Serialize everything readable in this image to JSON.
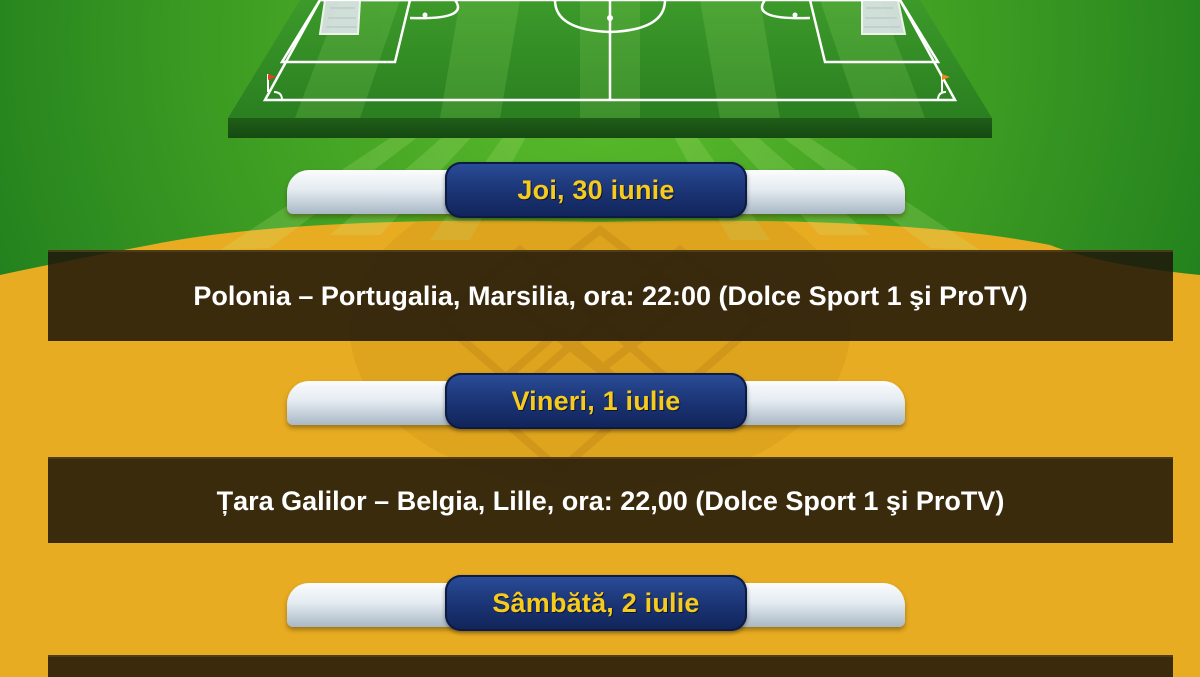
{
  "colors": {
    "background": "#e8ac22",
    "grass_dark": "#1e7d1e",
    "grass_light": "#59b32b",
    "day_text": "#f7cb1c",
    "day_plate": "#1a3373",
    "match_bar": "#1e160a",
    "match_text": "#ffffff"
  },
  "icons": [
    "football-pitch",
    "goal-net-left",
    "goal-net-right",
    "corner-flag-left",
    "corner-flag-right"
  ],
  "schedule": [
    {
      "day": "Joi, 30 iunie",
      "match": "Polonia – Portugalia, Marsilia, ora: 22:00 (Dolce Sport 1 şi ProTV)"
    },
    {
      "day": "Vineri, 1 iulie",
      "match": "Țara Galilor – Belgia, Lille, ora: 22,00 (Dolce Sport 1 şi ProTV)"
    },
    {
      "day": "Sâmbătă, 2 iulie",
      "match": ""
    }
  ]
}
